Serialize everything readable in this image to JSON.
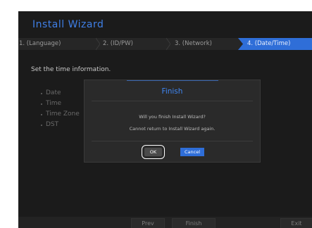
{
  "wizard": {
    "title": "Install Wizard",
    "steps": [
      {
        "label": "1.  (Language)"
      },
      {
        "label": "2.  (ID/PW)"
      },
      {
        "label": "3.  (Network)"
      },
      {
        "label": "4.  (Date/Time)"
      }
    ],
    "instruction": "Set the time information.",
    "fields": [
      "Date",
      "Time",
      "Time Zone",
      "DST"
    ]
  },
  "bottom_buttons": {
    "prev": "Prev",
    "finish": "Finish",
    "exit": "Exit"
  },
  "dialog": {
    "title": "Finish",
    "message_line1": "Will you finish Install Wizard?",
    "message_line2": "Cannot return to Install Wizard again.",
    "ok_label": "OK",
    "cancel_label": "Cancel"
  },
  "colors": {
    "accent": "#2f6ed8",
    "background": "#1b1b1b",
    "dialog": "#2a2a2a"
  }
}
